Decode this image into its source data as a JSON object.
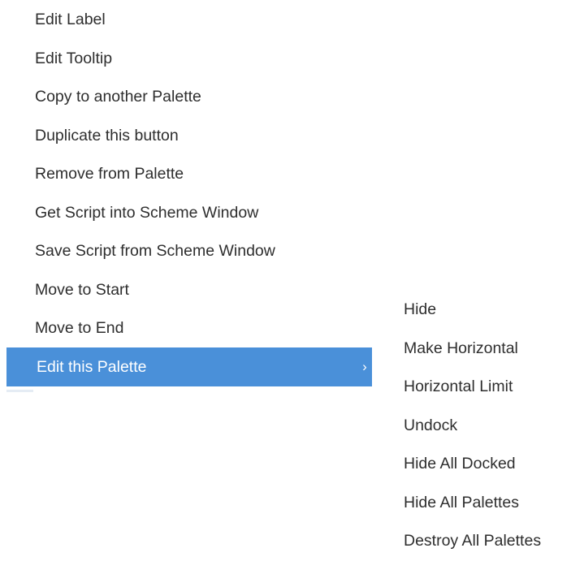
{
  "context_menu": {
    "items": [
      {
        "label": "Edit Label"
      },
      {
        "label": "Edit Tooltip"
      },
      {
        "label": "Copy to another Palette"
      },
      {
        "label": "Duplicate this button"
      },
      {
        "label": "Remove from Palette"
      },
      {
        "label": "Get Script into Scheme Window"
      },
      {
        "label": "Save Script from Scheme Window"
      },
      {
        "label": "Move to Start"
      },
      {
        "label": "Move to End"
      },
      {
        "label": "Edit this Palette",
        "selected": true,
        "has_submenu": true,
        "submenu_arrow": "›"
      }
    ],
    "selection_color": "#4a90d9"
  },
  "submenu": {
    "items": [
      {
        "label": "Hide"
      },
      {
        "label": "Make Horizontal"
      },
      {
        "label": "Horizontal Limit"
      },
      {
        "label": "Undock"
      },
      {
        "label": "Hide All Docked"
      },
      {
        "label": "Hide All Palettes"
      },
      {
        "label": "Destroy All Palettes"
      }
    ]
  }
}
